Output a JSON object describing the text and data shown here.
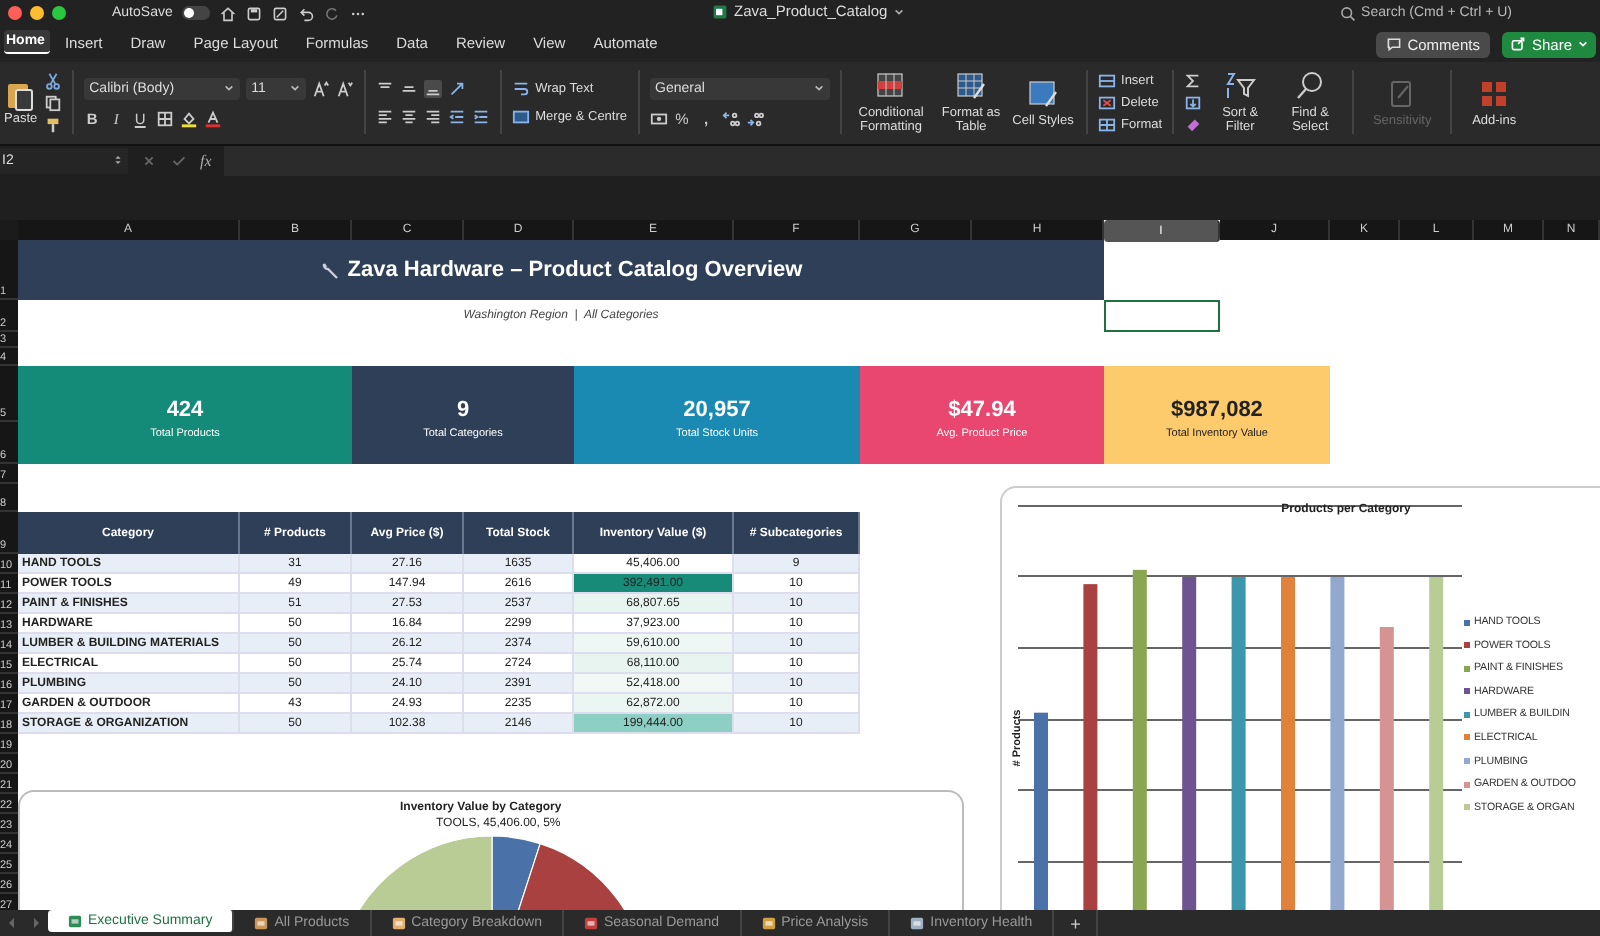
{
  "window": {
    "title": "Zava_Product_Catalog",
    "autosave": {
      "label": "AutoSave",
      "on": false
    },
    "search": {
      "placeholder": "Search (Cmd + Ctrl + U)"
    }
  },
  "ribbon_tabs": [
    {
      "label": "Home",
      "selected": true
    },
    {
      "label": "Insert",
      "selected": false
    },
    {
      "label": "Draw",
      "selected": false
    },
    {
      "label": "Page Layout",
      "selected": false
    },
    {
      "label": "Formulas",
      "selected": false
    },
    {
      "label": "Data",
      "selected": false
    },
    {
      "label": "Review",
      "selected": false
    },
    {
      "label": "View",
      "selected": false
    },
    {
      "label": "Automate",
      "selected": false
    }
  ],
  "actions": {
    "comments": "Comments",
    "share": "Share"
  },
  "ribbon": {
    "paste": "Paste",
    "font": "Calibri (Body)",
    "size": "11",
    "bold": "B",
    "italic": "I",
    "underline": "U",
    "wrap": "Wrap Text",
    "merge": "Merge & Centre",
    "number_format": "General",
    "percent": "%",
    "comma": ",",
    "conditional": "Conditional Formatting",
    "format_table": "Format as Table",
    "cell_styles": "Cell Styles",
    "insert": "Insert",
    "delete": "Delete",
    "format": "Format",
    "sort": "Sort & Filter",
    "find": "Find & Select",
    "sensitivity": {
      "label": "Sensitivity",
      "disabled": true
    },
    "addins": "Add-ins"
  },
  "formula_bar": {
    "name_box": "I2",
    "fx": "fx"
  },
  "columns": [
    {
      "label": "A",
      "selected": false
    },
    {
      "label": "B",
      "selected": false
    },
    {
      "label": "C",
      "selected": false
    },
    {
      "label": "D",
      "selected": false
    },
    {
      "label": "E",
      "selected": false
    },
    {
      "label": "F",
      "selected": false
    },
    {
      "label": "G",
      "selected": false
    },
    {
      "label": "H",
      "selected": false
    },
    {
      "label": "I",
      "selected": true
    },
    {
      "label": "J",
      "selected": false
    },
    {
      "label": "K",
      "selected": false
    },
    {
      "label": "L",
      "selected": false
    },
    {
      "label": "M",
      "selected": false
    },
    {
      "label": "N",
      "selected": false
    }
  ],
  "rows": [
    "1",
    "2",
    "3",
    "4",
    "5",
    "6",
    "7",
    "8",
    "9",
    "10",
    "11",
    "12",
    "13",
    "14",
    "15",
    "16",
    "17",
    "18",
    "19",
    "20",
    "21",
    "22",
    "23",
    "24",
    "25",
    "26",
    "27"
  ],
  "title_band": "Zava Hardware – Product Catalog Overview",
  "subtitle": "Washington Region  |  All Categories",
  "kpis": [
    {
      "value": "424",
      "label": "Total Products",
      "color": "#148a78"
    },
    {
      "value": "9",
      "label": "Total Categories",
      "color": "#2e3f57"
    },
    {
      "value": "20,957",
      "label": "Total Stock Units",
      "color": "#1a8ab2"
    },
    {
      "value": "$47.94",
      "label": "Avg. Product Price",
      "color": "#e9476f"
    },
    {
      "value": "$987,082",
      "label": "Total Inventory Value",
      "color": "#fecb6c"
    }
  ],
  "table": {
    "columns": [
      "Category",
      "# Products",
      "Avg Price ($)",
      "Total Stock",
      "Inventory Value ($)",
      "# Subcategories"
    ],
    "rows": [
      {
        "cells": [
          "HAND TOOLS",
          "31",
          "27.16",
          "1635",
          "45,406.00",
          "9"
        ],
        "color": "#ffffff"
      },
      {
        "cells": [
          "POWER TOOLS",
          "49",
          "147.94",
          "2616",
          "392,491.00",
          "10"
        ],
        "color": "#178a78"
      },
      {
        "cells": [
          "PAINT & FINISHES",
          "51",
          "27.53",
          "2537",
          "68,807.65",
          "10"
        ],
        "color": "#e8f4f0"
      },
      {
        "cells": [
          "HARDWARE",
          "50",
          "16.84",
          "2299",
          "37,923.00",
          "10"
        ],
        "color": "#ffffff"
      },
      {
        "cells": [
          "LUMBER & BUILDING MATERIALS",
          "50",
          "26.12",
          "2374",
          "59,610.00",
          "10"
        ],
        "color": "#eef7f4"
      },
      {
        "cells": [
          "ELECTRICAL",
          "50",
          "25.74",
          "2724",
          "68,110.00",
          "10"
        ],
        "color": "#e8f4f0"
      },
      {
        "cells": [
          "PLUMBING",
          "50",
          "24.10",
          "2391",
          "52,418.00",
          "10"
        ],
        "color": "#f1f8f5"
      },
      {
        "cells": [
          "GARDEN & OUTDOOR",
          "43",
          "24.93",
          "2235",
          "62,872.00",
          "10"
        ],
        "color": "#ebf5f2"
      },
      {
        "cells": [
          "STORAGE & ORGANIZATION",
          "50",
          "102.38",
          "2146",
          "199,444.00",
          "10"
        ],
        "color": "#8ecfc5"
      }
    ]
  },
  "bar_chart": {
    "title": "Products per Category",
    "ylabel": "# Products",
    "legend": [
      {
        "label": "HAND TOOLS",
        "color": "#4a72a8"
      },
      {
        "label": "POWER TOOLS",
        "color": "#a8413f"
      },
      {
        "label": "PAINT & FINISHES",
        "color": "#8aa653"
      },
      {
        "label": "HARDWARE",
        "color": "#6d5490"
      },
      {
        "label": "LUMBER & BUILDIN",
        "color": "#3c97ab"
      },
      {
        "label": "ELECTRICAL",
        "color": "#e0823a"
      },
      {
        "label": "PLUMBING",
        "color": "#91a9cf"
      },
      {
        "label": "GARDEN & OUTDOO",
        "color": "#d59493"
      },
      {
        "label": "STORAGE & ORGAN",
        "color": "#b9cc95"
      }
    ]
  },
  "pie_chart": {
    "title": "Inventory Value by Category",
    "data_label": "TOOLS, 45,406.00, 5%"
  },
  "sheet_tabs": [
    {
      "label": "Executive Summary",
      "selected": true
    },
    {
      "label": "All Products",
      "selected": false
    },
    {
      "label": "Category Breakdown",
      "selected": false
    },
    {
      "label": "Seasonal Demand",
      "selected": false
    },
    {
      "label": "Price Analysis",
      "selected": false
    },
    {
      "label": "Inventory Health",
      "selected": false
    }
  ],
  "add_sheet": "+"
}
